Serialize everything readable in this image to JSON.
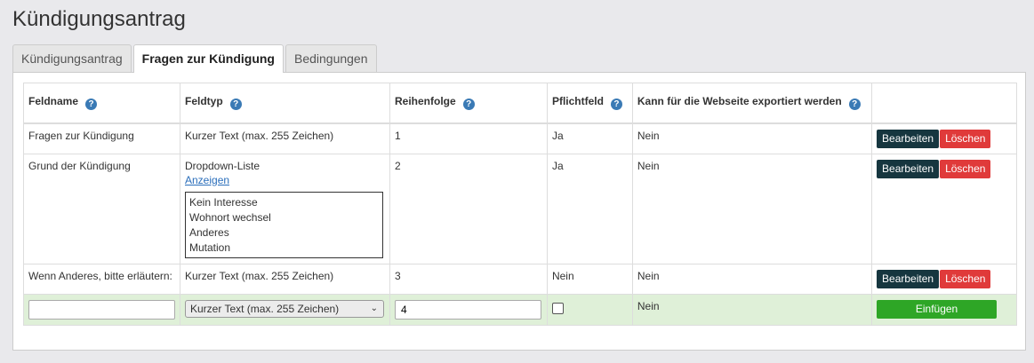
{
  "page": {
    "title": "Kündigungsantrag"
  },
  "tabs": [
    {
      "label": "Kündigungsantrag"
    },
    {
      "label": "Fragen zur Kündigung"
    },
    {
      "label": "Bedingungen"
    }
  ],
  "table": {
    "headers": {
      "fieldname": "Feldname",
      "fieldtype": "Feldtyp",
      "order": "Reihenfolge",
      "required": "Pflichtfeld",
      "exportable": "Kann für die Webseite exportiert werden"
    },
    "help_icon": "?",
    "rows": [
      {
        "fieldname": "Fragen zur Kündigung",
        "fieldtype": "Kurzer Text (max. 255 Zeichen)",
        "order": "1",
        "required": "Ja",
        "exportable": "Nein"
      },
      {
        "fieldname": "Grund der Kündigung",
        "fieldtype": "Dropdown-Liste",
        "show_link": "Anzeigen",
        "options": [
          "Kein Interesse",
          "Wohnort wechsel",
          "Anderes",
          "Mutation"
        ],
        "order": "2",
        "required": "Ja",
        "exportable": "Nein"
      },
      {
        "fieldname": "Wenn Anderes, bitte erläutern:",
        "fieldtype": "Kurzer Text (max. 255 Zeichen)",
        "order": "3",
        "required": "Nein",
        "exportable": "Nein"
      }
    ],
    "new_row": {
      "fieldname_value": "",
      "fieldtype_selected": "Kurzer Text (max. 255 Zeichen)",
      "order_value": "4",
      "required_checked": false,
      "exportable": "Nein"
    },
    "buttons": {
      "edit": "Bearbeiten",
      "delete": "Löschen",
      "insert": "Einfügen"
    }
  },
  "colors": {
    "edit_button": "#16363f",
    "delete_button": "#e03a3a",
    "insert_button": "#2ea626",
    "help_icon": "#3a7ab5",
    "new_row_bg": "#dff0d8"
  }
}
